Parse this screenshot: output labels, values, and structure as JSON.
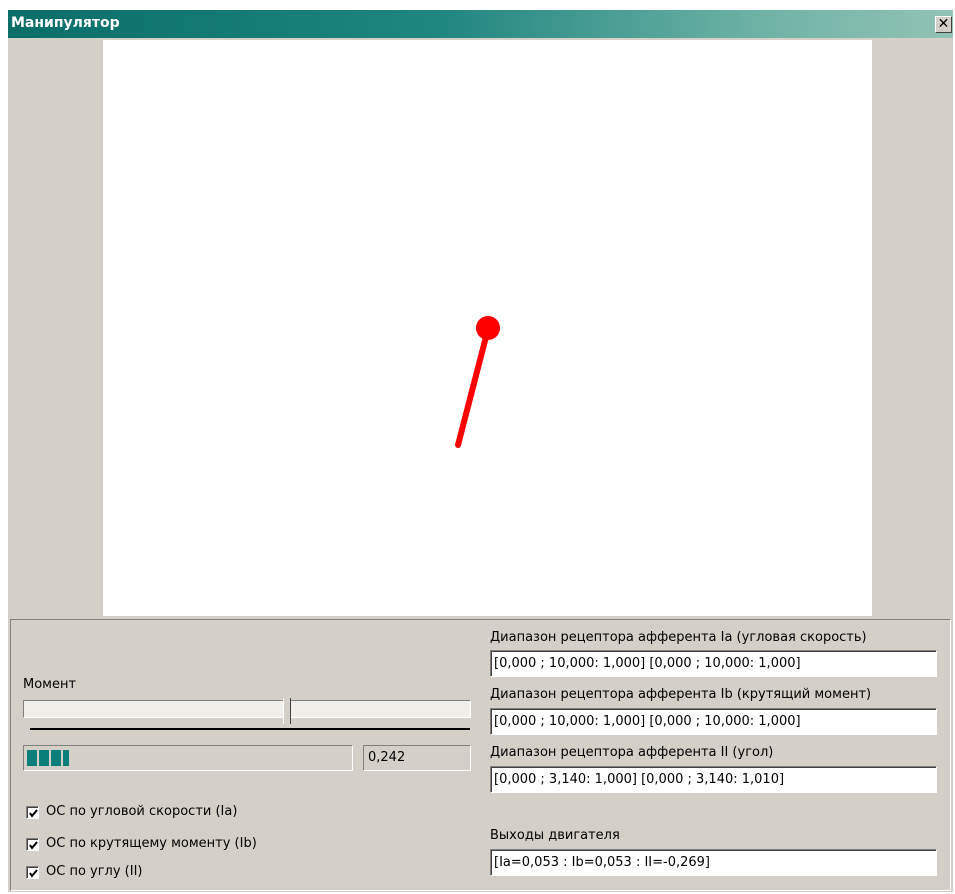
{
  "window": {
    "title": "Манипулятор",
    "close_glyph": "✕"
  },
  "controls": {
    "moment_label": "Момент",
    "moment_value": "0,242",
    "moment_slider_fraction": 0.59,
    "progress_fraction": 0.13,
    "checkboxes": [
      {
        "label": "ОС по угловой скорости (Ia)",
        "checked": true
      },
      {
        "label": "ОС по крутящему моменту (Ib)",
        "checked": true
      },
      {
        "label": "ОС по углу (II)",
        "checked": true
      }
    ]
  },
  "fields": [
    {
      "label": "Диапазон рецептора афферента Ia (угловая скорость)",
      "value": "[0,000 ; 10,000: 1,000] [0,000 ; 10,000: 1,000]"
    },
    {
      "label": "Диапазон рецептора афферента Ib (крутящий момент)",
      "value": "[0,000 ; 10,000: 1,000] [0,000 ; 10,000: 1,000]"
    },
    {
      "label": "Диапазон рецептора афферента II (угол)",
      "value": "[0,000 ; 3,140: 1,000] [0,000 ; 3,140: 1,010]"
    },
    {
      "label": "Выходы двигателя",
      "value": "[Ia=0,053 : Ib=0,053 : II=-0,269]"
    }
  ],
  "colors": {
    "arm": "#ff0000",
    "title_gradient_start": "#0a6e68",
    "progress": "#0a7e78"
  }
}
